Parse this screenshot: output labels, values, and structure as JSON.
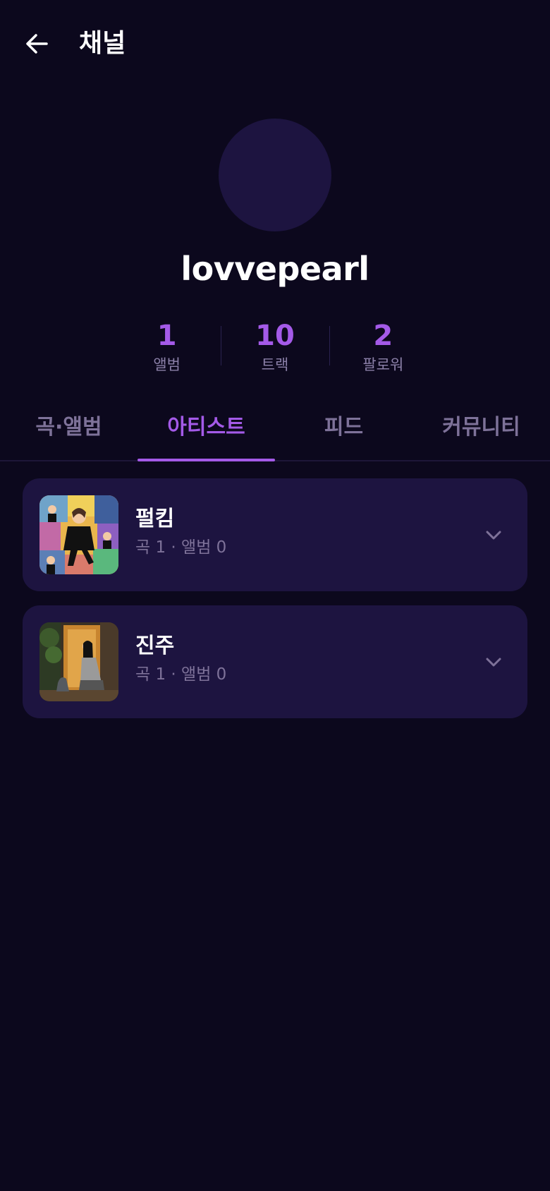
{
  "header": {
    "back_icon": "arrow-left-icon",
    "title": "채널"
  },
  "profile": {
    "channel_name": "lovvepearl"
  },
  "stats": [
    {
      "value": "1",
      "label": "앨범"
    },
    {
      "value": "10",
      "label": "트랙"
    },
    {
      "value": "2",
      "label": "팔로워"
    }
  ],
  "tabs": [
    {
      "label": "곡·앨범"
    },
    {
      "label": "아티스트",
      "active": true
    },
    {
      "label": "피드"
    },
    {
      "label": "커뮤니티"
    }
  ],
  "artists": [
    {
      "name": "펄킴",
      "meta": "곡 1 · 앨범 0",
      "thumbnail": "collage-illustration"
    },
    {
      "name": "진주",
      "meta": "곡 1 · 앨범 0",
      "thumbnail": "doorway-photo"
    }
  ],
  "colors": {
    "background": "#0c081d",
    "card": "#1d1440",
    "accent": "#a45ae8",
    "muted": "#7e7299"
  }
}
